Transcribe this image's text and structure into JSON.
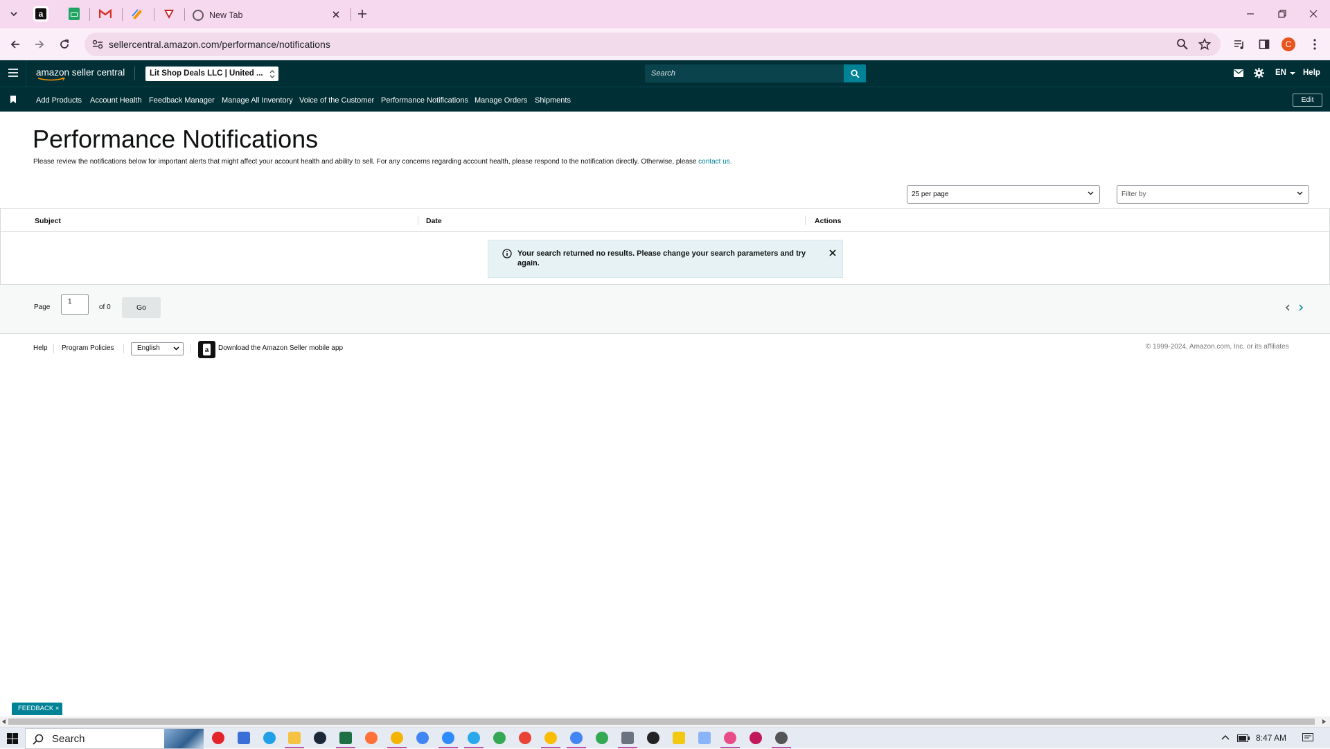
{
  "browser": {
    "active_tab_title": "New Tab",
    "url": "sellercentral.amazon.com/performance/notifications",
    "profile_initial": "C"
  },
  "header": {
    "logo": "amazon seller central",
    "store_selector": "Lit Shop Deals LLC | United ...",
    "search_placeholder": "Search",
    "language": "EN",
    "help": "Help"
  },
  "nav": {
    "items": [
      "Add Products",
      "Account Health",
      "Feedback Manager",
      "Manage All Inventory",
      "Voice of the Customer",
      "Performance Notifications",
      "Manage Orders",
      "Shipments"
    ],
    "edit": "Edit"
  },
  "main": {
    "title": "Performance Notifications",
    "intro_text": "Please review the notifications below for important alerts that might affect your account health and ability to sell. For any concerns regarding account health, please respond to the notification directly. Otherwise, please",
    "intro_link": "contact us.",
    "per_page": "25 per page",
    "filter_placeholder": "Filter by",
    "columns": [
      "Subject",
      "Date",
      "Actions"
    ],
    "alert_text": "Your search returned no results. Please change your search parameters and try again.",
    "pager": {
      "label": "Page",
      "current": "1",
      "of": "of 0",
      "go": "Go"
    }
  },
  "footer": {
    "help": "Help",
    "program_policies": "Program Policies",
    "language": "English",
    "app_promo": "Download the Amazon Seller mobile app",
    "copyright": "© 1999-2024, Amazon.com, Inc. or its affiliates"
  },
  "feedback_tab": "FEEDBACK ×",
  "taskbar": {
    "search": "Search",
    "time": "8:47 AM"
  },
  "colors": {
    "header_bg": "#002f36",
    "accent": "#008296",
    "tab_strip": "#f7d9ef",
    "alert_bg": "#e6f2f4"
  }
}
